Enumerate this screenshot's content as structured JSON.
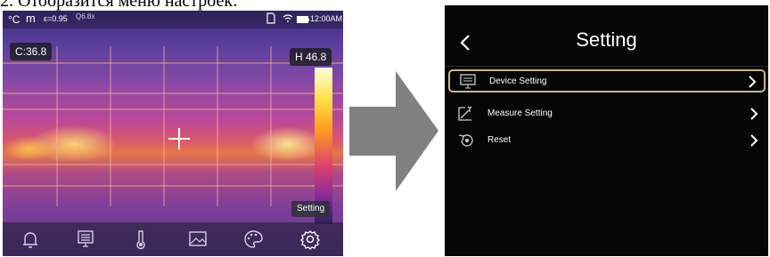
{
  "caption": "2. Отобразится меню настроек:",
  "camera": {
    "status": {
      "unit": "°C",
      "mode": "m",
      "emissivity": "ε=0.95",
      "zoom": "Q6.8x",
      "time": "12:00AM"
    },
    "center_marker": "C:36.8",
    "high_marker": "H 46.8",
    "tooltip": "Setting",
    "bottom_icons": [
      "bell-icon",
      "monitor-icon",
      "thermometer-icon",
      "image-icon",
      "palette-icon",
      "gear-icon"
    ]
  },
  "settings": {
    "title": "Setting",
    "items": [
      {
        "label": "Device Setting",
        "icon": "monitor-icon",
        "selected": true
      },
      {
        "label": "Measure Setting",
        "icon": "measure-icon",
        "selected": false
      },
      {
        "label": "Reset",
        "icon": "reset-icon",
        "selected": false
      }
    ]
  },
  "colors": {
    "selection_border": "#c9b98a",
    "settings_bg": "#050505",
    "arrow": "#808080"
  }
}
